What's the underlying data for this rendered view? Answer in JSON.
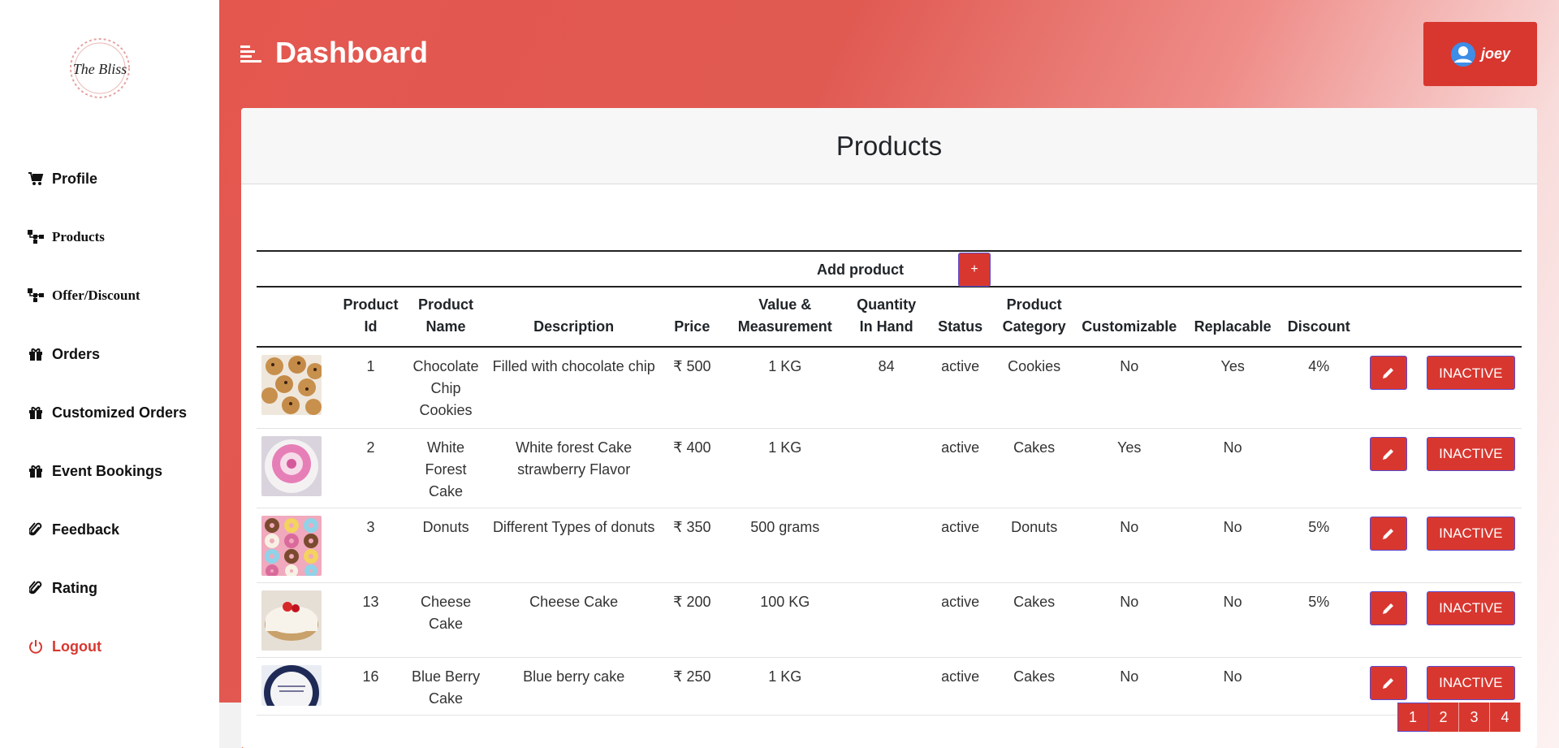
{
  "brand": {
    "logo_text": "The Bliss"
  },
  "sidebar": {
    "items": [
      {
        "label": "Profile",
        "icon": "cart-icon"
      },
      {
        "label": "Products",
        "icon": "sitemap-icon"
      },
      {
        "label": "Offer/Discount",
        "icon": "sitemap-icon"
      },
      {
        "label": "Orders",
        "icon": "gift-icon"
      },
      {
        "label": "Customized Orders",
        "icon": "gift-icon"
      },
      {
        "label": "Event Bookings",
        "icon": "gift-icon"
      },
      {
        "label": "Feedback",
        "icon": "paperclip-icon"
      },
      {
        "label": "Rating",
        "icon": "paperclip-icon"
      },
      {
        "label": "Logout",
        "icon": "power-icon"
      }
    ]
  },
  "header": {
    "title": "Dashboard",
    "user": "joey"
  },
  "card": {
    "title": "Products",
    "add_label": "Add product",
    "add_button": "+"
  },
  "table": {
    "headers": [
      "",
      "Product Id",
      "Product Name",
      "Description",
      "Price",
      "Value & Measurement",
      "Quantity In Hand",
      "Status",
      "Product Category",
      "Customizable",
      "Replacable",
      "Discount",
      "",
      ""
    ],
    "rows": [
      {
        "id": "1",
        "name": "Chocolate Chip Cookies",
        "description": "Filled with chocolate chip",
        "price": "₹ 500",
        "measure": "1 KG",
        "qty": "84",
        "status": "active",
        "category": "Cookies",
        "customizable": "No",
        "replacable": "Yes",
        "discount": "4%",
        "action": "INACTIVE",
        "image": "cookies"
      },
      {
        "id": "2",
        "name": "White Forest Cake",
        "description": "White forest Cake strawberry Flavor",
        "price": "₹ 400",
        "measure": "1 KG",
        "qty": "",
        "status": "active",
        "category": "Cakes",
        "customizable": "Yes",
        "replacable": "No",
        "discount": "",
        "action": "INACTIVE",
        "image": "pink-cake"
      },
      {
        "id": "3",
        "name": "Donuts",
        "description": "Different Types of donuts",
        "price": "₹ 350",
        "measure": "500 grams",
        "qty": "",
        "status": "active",
        "category": "Donuts",
        "customizable": "No",
        "replacable": "No",
        "discount": "5%",
        "action": "INACTIVE",
        "image": "donuts"
      },
      {
        "id": "13",
        "name": "Cheese Cake",
        "description": "Cheese Cake",
        "price": "₹ 200",
        "measure": "100 KG",
        "qty": "",
        "status": "active",
        "category": "Cakes",
        "customizable": "No",
        "replacable": "No",
        "discount": "5%",
        "action": "INACTIVE",
        "image": "cheesecake"
      },
      {
        "id": "16",
        "name": "Blue Berry Cake",
        "description": "Blue berry cake",
        "price": "₹ 250",
        "measure": "1 KG",
        "qty": "",
        "status": "active",
        "category": "Cakes",
        "customizable": "No",
        "replacable": "No",
        "discount": "",
        "action": "INACTIVE",
        "image": "blueberry-cake"
      }
    ]
  },
  "pagination": {
    "pages": [
      "1",
      "2",
      "3",
      "4"
    ],
    "current": "1"
  },
  "colors": {
    "accent": "#d8372f",
    "header_gradient_start": "#e4574f"
  }
}
